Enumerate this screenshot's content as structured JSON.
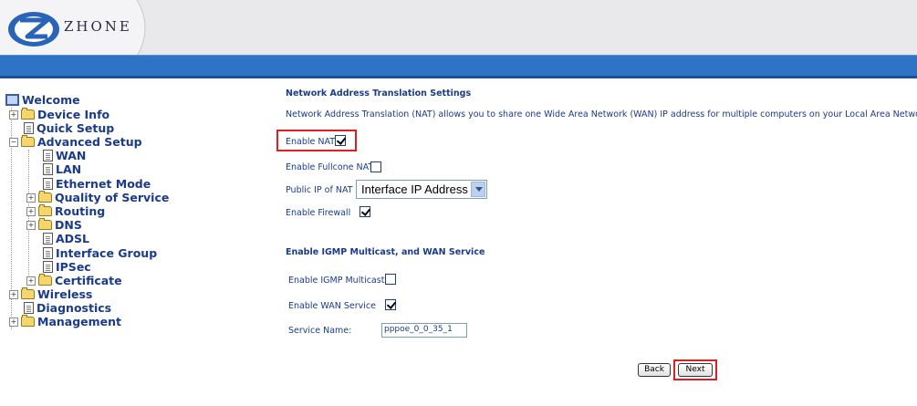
{
  "brand": {
    "logo_text": "ZHONE"
  },
  "nav": {
    "items": [
      {
        "label": "Welcome"
      },
      {
        "label": "Device Info"
      },
      {
        "label": "Quick Setup"
      },
      {
        "label": "Advanced Setup"
      },
      {
        "label": "WAN"
      },
      {
        "label": "LAN"
      },
      {
        "label": "Ethernet Mode"
      },
      {
        "label": "Quality of Service"
      },
      {
        "label": "Routing"
      },
      {
        "label": "DNS"
      },
      {
        "label": "ADSL"
      },
      {
        "label": "Interface Group"
      },
      {
        "label": "IPSec"
      },
      {
        "label": "Certificate"
      },
      {
        "label": "Wireless"
      },
      {
        "label": "Diagnostics"
      },
      {
        "label": "Management"
      }
    ]
  },
  "nat": {
    "title": "Network Address Translation Settings",
    "description": "Network Address Translation (NAT) allows you to share one Wide Area Network (WAN) IP address for multiple computers on your Local Area Network (LAN).",
    "enable_nat_label": "Enable NAT",
    "enable_nat_checked": true,
    "enable_fullcone_label": "Enable Fullcone NAT",
    "enable_fullcone_checked": false,
    "public_ip_label": "Public IP of NAT :",
    "public_ip_value": "Interface IP Address",
    "enable_firewall_label": "Enable Firewall",
    "enable_firewall_checked": true
  },
  "igmp": {
    "title": "Enable IGMP Multicast, and WAN Service",
    "enable_igmp_label": "Enable IGMP Multicast",
    "enable_igmp_checked": false,
    "enable_wan_label": "Enable WAN Service",
    "enable_wan_checked": true,
    "service_name_label": "Service Name:",
    "service_name_value": "pppoe_0_0_35_1"
  },
  "buttons": {
    "back": "Back",
    "next": "Next"
  },
  "colors": {
    "header_blue": "#2f73c6",
    "text_blue": "#1a3a8c",
    "highlight_red": "#e21c22"
  }
}
